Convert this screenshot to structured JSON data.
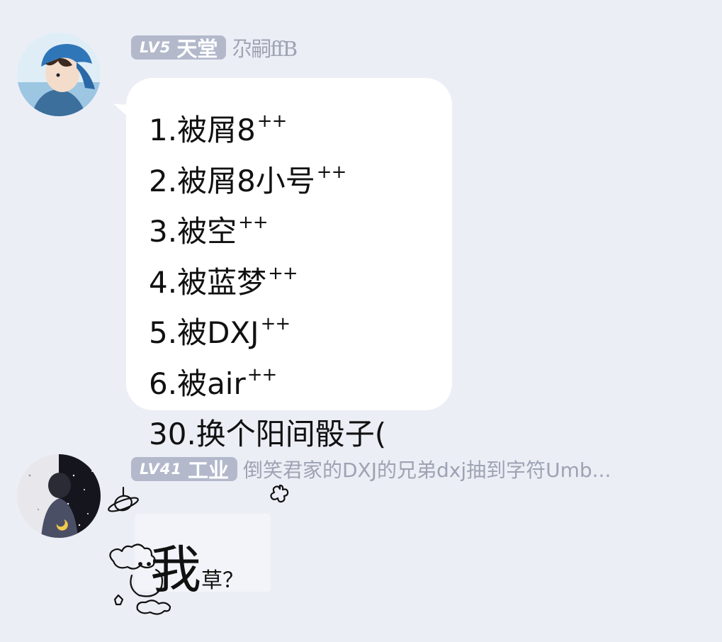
{
  "messages": [
    {
      "level": "LV5",
      "title": "天堂",
      "username": "尕嗣ffB",
      "lines": [
        {
          "text": "1.被屑8",
          "suffix": "++"
        },
        {
          "text": "2.被屑8小号",
          "suffix": "++"
        },
        {
          "text": "3.被空",
          "suffix": "++"
        },
        {
          "text": "4.被蓝梦",
          "suffix": "++"
        },
        {
          "text": "5.被DXJ",
          "suffix": "++"
        },
        {
          "text": "6.被air",
          "suffix": "++"
        },
        {
          "text": "30.换个阳间骰子(",
          "suffix": ""
        }
      ]
    },
    {
      "level": "LV41",
      "title": "工业",
      "username": "倒笑君家的DXJ的兄弟dxj抽到字符Umb...",
      "big_text": "我",
      "small_text": "草？"
    }
  ],
  "colors": {
    "background": "#eceef6",
    "badge": "#b3b9cb",
    "bubble": "#ffffff",
    "username": "#9ea3b3"
  }
}
